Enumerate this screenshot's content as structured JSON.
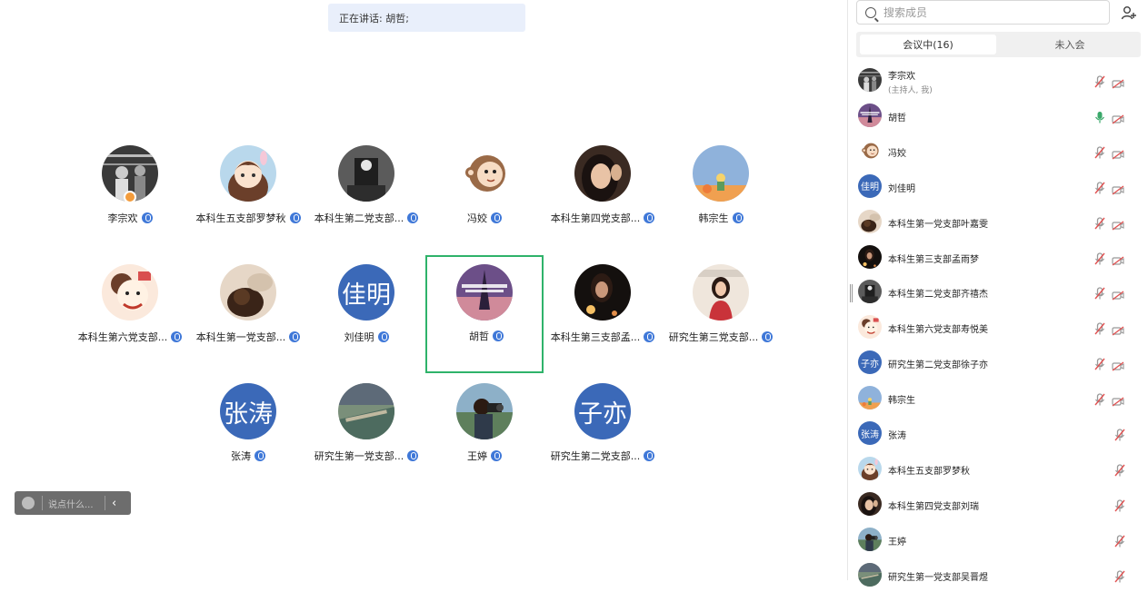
{
  "speaking": {
    "label": "正在讲话: 胡哲;"
  },
  "grid": [
    {
      "name": "李宗欢",
      "avatar": "photo-boxing",
      "host": true
    },
    {
      "name": "本科生五支部罗梦秋",
      "avatar": "cartoon-girl"
    },
    {
      "name": "本科生第二党支部...",
      "avatar": "photo-dark"
    },
    {
      "name": "冯姣",
      "avatar": "cartoon-monkey"
    },
    {
      "name": "本科生第四党支部...",
      "avatar": "photo-woman"
    },
    {
      "name": "韩宗生",
      "avatar": "little-prince"
    },
    {
      "name": "本科生第六党支部...",
      "avatar": "cartoon-crayon"
    },
    {
      "name": "本科生第一党支部...",
      "avatar": "photo-dog"
    },
    {
      "name": "刘佳明",
      "avatar_text": "佳明"
    },
    {
      "name": "胡哲",
      "avatar": "photo-eiffel",
      "active": true
    },
    {
      "name": "本科生第三支部孟...",
      "avatar": "photo-candle"
    },
    {
      "name": "研究生第三党支部...",
      "avatar": "photo-girl-red"
    },
    {
      "name": "张涛",
      "avatar_text": "张涛"
    },
    {
      "name": "研究生第一党支部...",
      "avatar": "photo-scenery"
    },
    {
      "name": "王婷",
      "avatar": "photo-camera"
    },
    {
      "name": "研究生第二党支部...",
      "avatar_text": "子亦"
    }
  ],
  "chat": {
    "placeholder": "说点什么...",
    "chevron": "‹"
  },
  "panel": {
    "search_placeholder": "搜索成员",
    "tab_in": "会议中(16)",
    "tab_out": "未入会",
    "members": [
      {
        "name": "李宗欢",
        "sub": "(主持人, 我)",
        "avatar": "photo-boxing",
        "mic": "muted",
        "cam": "off"
      },
      {
        "name": "胡哲",
        "avatar": "photo-eiffel",
        "mic": "on",
        "cam": "off"
      },
      {
        "name": "冯姣",
        "avatar": "cartoon-monkey",
        "mic": "muted",
        "cam": "off"
      },
      {
        "name": "刘佳明",
        "avatar_text": "佳明",
        "mic": "muted",
        "cam": "off"
      },
      {
        "name": "本科生第一党支部叶嘉雯",
        "avatar": "photo-dog",
        "mic": "muted",
        "cam": "off"
      },
      {
        "name": "本科生第三支部孟雨梦",
        "avatar": "photo-candle",
        "mic": "muted",
        "cam": "off"
      },
      {
        "name": "本科生第二党支部齐禧杰",
        "avatar": "photo-dark",
        "mic": "muted",
        "cam": "off"
      },
      {
        "name": "本科生第六党支部寿悦美",
        "avatar": "cartoon-crayon",
        "mic": "muted",
        "cam": "off"
      },
      {
        "name": "研究生第二党支部徐子亦",
        "avatar_text": "子亦",
        "mic": "muted",
        "cam": "off"
      },
      {
        "name": "韩宗生",
        "avatar": "little-prince",
        "mic": "muted",
        "cam": "off"
      },
      {
        "name": "张涛",
        "avatar_text": "张涛",
        "mic": "muted"
      },
      {
        "name": "本科生五支部罗梦秋",
        "avatar": "cartoon-girl",
        "mic": "muted"
      },
      {
        "name": "本科生第四党支部刘瑞",
        "avatar": "photo-woman",
        "mic": "muted"
      },
      {
        "name": "王婷",
        "avatar": "photo-camera",
        "mic": "muted"
      },
      {
        "name": "研究生第一党支部吴晋煜",
        "avatar": "photo-scenery",
        "mic": "muted"
      }
    ]
  },
  "icons": {
    "search": "search-icon",
    "add_member": "add-member-icon",
    "mic_muted": "mic-muted-icon",
    "mic_on": "mic-on-icon",
    "camera_off": "camera-off-icon"
  },
  "colors": {
    "accent_blue": "#3f78d8",
    "text_avatar_bg": "#3b69b8",
    "active_border": "#2fb36a",
    "muted_red": "#e05252",
    "mic_on_green": "#3aa86a",
    "speaking_bg": "#e9effb"
  }
}
